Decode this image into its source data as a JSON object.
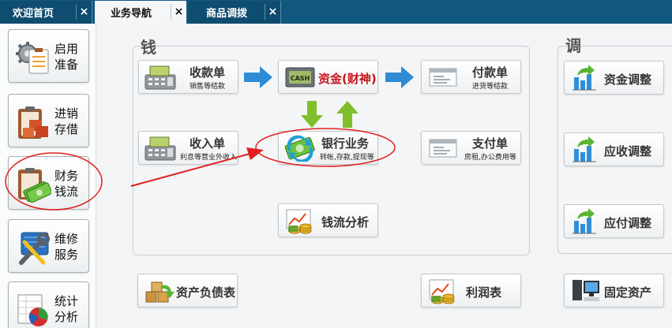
{
  "tabs": [
    {
      "label": "欢迎首页",
      "close": "×",
      "active": false
    },
    {
      "label": "业务导航",
      "close": "×",
      "active": true
    },
    {
      "label": "商品调拨",
      "close": "×",
      "active": false
    }
  ],
  "sidebar": {
    "items": [
      {
        "label": "启用\n准备",
        "icon": "gear-clipboard-icon"
      },
      {
        "label": "进销\n存借",
        "icon": "boxes-clipboard-icon"
      },
      {
        "label": "财务\n钱流",
        "icon": "money-clipboard-icon"
      },
      {
        "label": "维修\n服务",
        "icon": "tools-icon"
      },
      {
        "label": "统计\n分析",
        "icon": "pie-chart-icon"
      }
    ]
  },
  "money_panel": {
    "title": "钱",
    "receipt": {
      "title": "收款单",
      "subtitle": "销售等结款",
      "icon": "cash-register-icon"
    },
    "funds": {
      "title": "资金(财神)",
      "icon": "cash-box-icon"
    },
    "payment": {
      "title": "付款单",
      "subtitle": "进货等结款",
      "icon": "receipt-icon"
    },
    "income": {
      "title": "收入单",
      "subtitle": "利息等营业外收入",
      "icon": "cash-register-icon"
    },
    "bank": {
      "title": "银行业务",
      "subtitle": "转帐,存款,提现等",
      "icon": "money-exchange-icon"
    },
    "expense": {
      "title": "支付单",
      "subtitle": "房租,办公费用等",
      "icon": "receipt-icon"
    },
    "cashflow": {
      "title": "钱流分析",
      "icon": "coins-chart-icon"
    }
  },
  "adjust_panel": {
    "title": "调",
    "items": [
      {
        "title": "资金调整",
        "icon": "bar-chart-arrow-icon"
      },
      {
        "title": "应收调整",
        "icon": "bar-chart-arrow-icon"
      },
      {
        "title": "应付调整",
        "icon": "bar-chart-arrow-icon"
      }
    ]
  },
  "bottom": {
    "balance_sheet": {
      "title": "资产负债表",
      "icon": "boxes-arrow-icon"
    },
    "profit": {
      "title": "利润表",
      "icon": "coins-chart-icon"
    },
    "fixed_assets": {
      "title": "固定资产",
      "icon": "computer-icon"
    }
  },
  "colors": {
    "tabbar": "#11577e",
    "accent_red": "#c8131b",
    "arrow_blue": "#2e8bd6",
    "arrow_green": "#7fbf2a",
    "annotation": "#e02020"
  }
}
